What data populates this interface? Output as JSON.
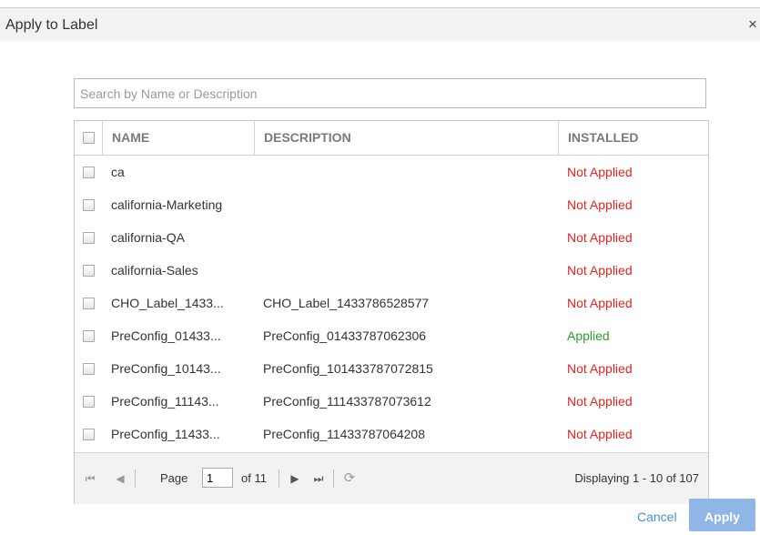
{
  "dialog": {
    "title": "Apply to Label",
    "close_symbol": "×"
  },
  "search": {
    "placeholder": "Search by Name or Description",
    "value": ""
  },
  "table": {
    "columns": {
      "name": "NAME",
      "description": "DESCRIPTION",
      "installed": "INSTALLED"
    },
    "rows": [
      {
        "name": "ca",
        "description": "",
        "installed": "Not Applied",
        "status": "not_applied"
      },
      {
        "name": "california-Marketing",
        "description": "",
        "installed": "Not Applied",
        "status": "not_applied"
      },
      {
        "name": "california-QA",
        "description": "",
        "installed": "Not Applied",
        "status": "not_applied"
      },
      {
        "name": "california-Sales",
        "description": "",
        "installed": "Not Applied",
        "status": "not_applied"
      },
      {
        "name": "CHO_Label_1433...",
        "description": "CHO_Label_1433786528577",
        "installed": "Not Applied",
        "status": "not_applied"
      },
      {
        "name": "PreConfig_01433...",
        "description": "PreConfig_01433787062306",
        "installed": "Applied",
        "status": "applied"
      },
      {
        "name": "PreConfig_10143...",
        "description": "PreConfig_101433787072815",
        "installed": "Not Applied",
        "status": "not_applied"
      },
      {
        "name": "PreConfig_11143...",
        "description": "PreConfig_111433787073612",
        "installed": "Not Applied",
        "status": "not_applied"
      },
      {
        "name": "PreConfig_11433...",
        "description": "PreConfig_11433787064208",
        "installed": "Not Applied",
        "status": "not_applied"
      }
    ]
  },
  "pager": {
    "page_label": "Page",
    "page_value": "1",
    "of_label": "of 11",
    "display_text": "Displaying 1 - 10 of 107",
    "first_symbol": "⏮",
    "prev_symbol": "◀",
    "next_symbol": "▶",
    "last_symbol": "⏭",
    "refresh_symbol": "⟳"
  },
  "footer": {
    "cancel_label": "Cancel",
    "apply_label": "Apply"
  },
  "colors": {
    "not_applied": "#e8231f",
    "applied": "#2c9b2c",
    "link": "#4a90d9",
    "apply_bg": "#8fb6e4"
  }
}
